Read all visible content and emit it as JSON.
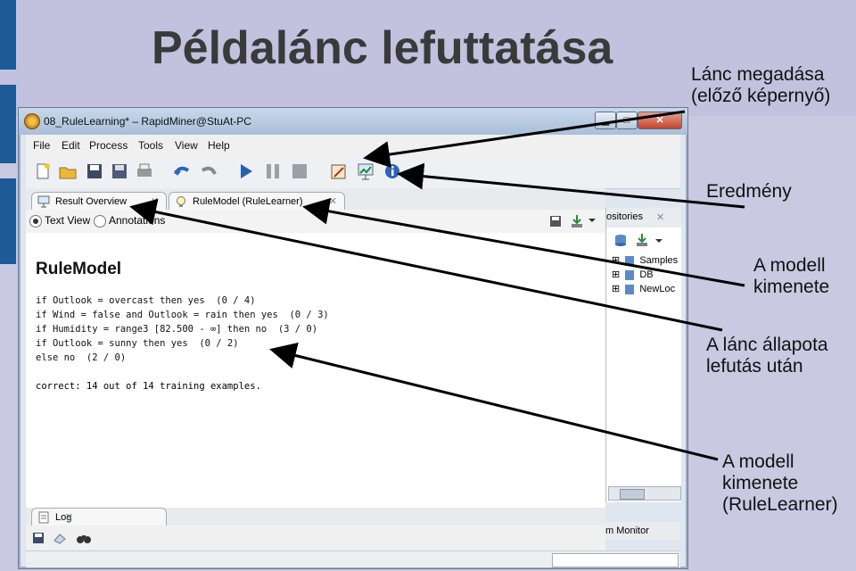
{
  "slide": {
    "title": "Példalánc lefuttatása",
    "annotations": {
      "chain": "Lánc megadása\n(előző képernyő)",
      "result": "Eredmény",
      "model_output": "A modell\nkimenete",
      "chain_state": "A lánc állapota\nlefutás után",
      "model_output_rulelearner": "A modell\nkimenete\n(RuleLearner)"
    },
    "colors": {
      "background": "#c9c9e2",
      "accent_bar": "#1f5a98"
    }
  },
  "window": {
    "title": "08_RuleLearning* – RapidMiner@StuAt-PC",
    "controls": {
      "minimize": "▁",
      "maximize": "□",
      "close": "✕"
    },
    "menu": [
      "File",
      "Edit",
      "Process",
      "Tools",
      "View",
      "Help"
    ],
    "toolbar_icons": [
      "new-process-icon",
      "open-icon",
      "save-icon",
      "save-as-icon",
      "print-icon",
      "undo-icon",
      "redo-icon",
      "run-icon",
      "pause-icon",
      "stop-icon",
      "design-perspective-icon",
      "result-perspective-icon",
      "welcome-icon"
    ],
    "tabs": [
      {
        "label": "Result Overview",
        "close": "✕"
      },
      {
        "label": "RuleModel (RuleLearner)",
        "close": "✕"
      }
    ],
    "view_options": {
      "text_view": "Text View",
      "annotations": "Annotations"
    },
    "result": {
      "title": "RuleModel",
      "rules": [
        "if Outlook = overcast then yes  (0 / 4)",
        "if Wind = false and Outlook = rain then yes  (0 / 3)",
        "if Humidity = range3 [82.500 - ∞] then no  (3 / 0)",
        "if Outlook = sunny then yes  (0 / 2)",
        "else no  (2 / 0)"
      ],
      "summary": "correct: 14 out of 14 training examples."
    },
    "repositories": {
      "header": "ositories",
      "close": "✕",
      "items": [
        {
          "expand": "⊞",
          "label": "Samples"
        },
        {
          "expand": "⊞",
          "label": "DB"
        },
        {
          "expand": "⊞",
          "label": "NewLoc"
        }
      ]
    },
    "log_tab": {
      "label": "Log",
      "close": "✕"
    },
    "monitor_tab": {
      "label": "m Monitor"
    }
  }
}
